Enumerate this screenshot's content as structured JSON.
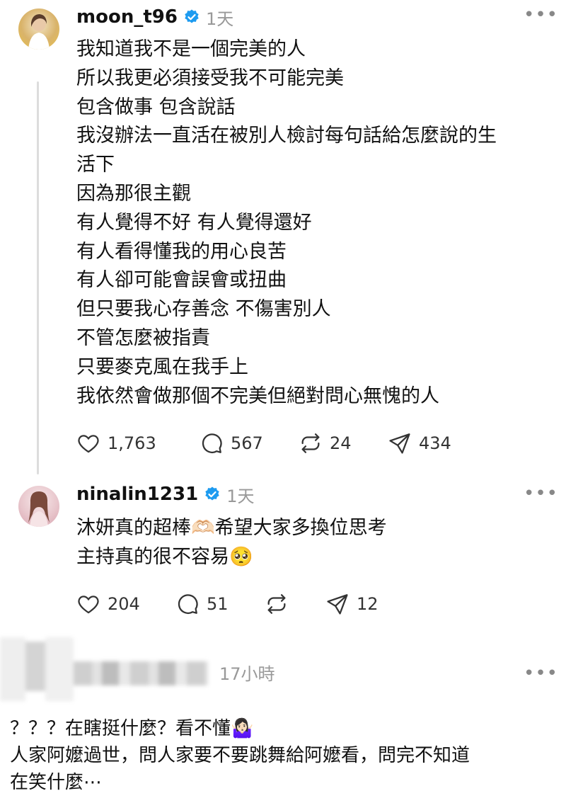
{
  "posts": [
    {
      "username": "moon_t96",
      "time": "1天",
      "lines": [
        "我知道我不是一個完美的人",
        "所以我更必須接受我不可能完美",
        "包含做事 包含說話",
        "我沒辦法一直活在被別人檢討每句話給怎麼說的生",
        "活下",
        "因為那很主觀",
        "有人覺得不好 有人覺得還好",
        "有人看得懂我的用心良苦",
        "有人卻可能會誤會或扭曲",
        "但只要我心存善念 不傷害別人",
        "不管怎麼被指責",
        "只要麥克風在我手上",
        "我依然會做那個不完美但絕對問心無愧的人"
      ],
      "likes": "1,763",
      "comments": "567",
      "reposts": "24",
      "shares": "434"
    },
    {
      "username": "ninalin1231",
      "time": "1天",
      "lines": [
        "沐妍真的超棒🫶🏻希望大家多換位思考",
        "主持真的很不容易🥺"
      ],
      "likes": "204",
      "comments": "51",
      "reposts": "",
      "shares": "12"
    }
  ],
  "third_comment": {
    "time": "17小時",
    "lines": [
      "？？？在瞎挺什麼？看不懂🤷🏻‍♀️",
      "人家阿嬤過世，問人家要不要跳舞給阿嬤看，問完不知道",
      "在笑什麼⋯"
    ]
  },
  "colors": {
    "verified": "#1d9bf0",
    "text": "#111111",
    "muted": "#999999"
  }
}
